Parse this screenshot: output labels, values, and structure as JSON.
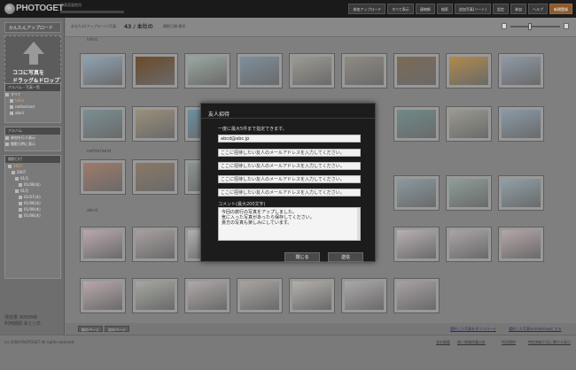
{
  "header": {
    "logo_text": "PHOTOGET",
    "logo_sub": "dreams",
    "meta_text": "写真容量使用",
    "nav": [
      "参加アップロード",
      "すべて表示",
      "連絡帳",
      "検索",
      "追加写真(ソート)",
      "設定",
      "参加",
      "ヘルプ",
      "新規登録"
    ]
  },
  "sidebar": {
    "upload_label": "かんたんアップロード",
    "drop_line1": "ココに写真を",
    "drop_line2": "ドラッグ&ドロップ",
    "albums_header": "アルバム・写真一覧",
    "albums": [
      {
        "label": "すべて",
        "style": "normal"
      },
      {
        "label": "tokio",
        "style": "orange"
      },
      {
        "label": "netherland",
        "style": "normal"
      },
      {
        "label": "abcd",
        "style": "normal"
      }
    ],
    "sub_header": "アルバム",
    "sub_items": [
      "参加を行う表示",
      "撮影日時に表示"
    ],
    "dates_header": "撮影日付",
    "dates": [
      "2007",
      "2007",
      "01月",
      "01/08(木)",
      "01月",
      "01/07(木)",
      "01/08(木)",
      "01/09(木)",
      "01/08(木)"
    ],
    "storage_line1": "残容量 9056MB",
    "storage_line2": "利用期間 あと○日"
  },
  "toolbar": {
    "count_label": "あなたの(アップロード)写真",
    "count_value": "43 / 本社の",
    "sort_label": "撮影日順 最初"
  },
  "groups": [
    {
      "label": "tokio"
    },
    {
      "label": "netherland"
    },
    {
      "label": "abcd"
    }
  ],
  "thumb_colors": {
    "row1": [
      "#8fa3b3",
      "#6b4a2a",
      "#9aa8a0",
      "#7e8f9c",
      "#9c9a92",
      "#8f8b82",
      "#7c6a55",
      "#b08a4a",
      "#8f99a6",
      "#6e5a50"
    ],
    "row2": [
      "#7a8f94",
      "#9a8f7a",
      "#6d8fa0",
      "#7f8c6a",
      "#8f7a6a",
      "#7a7e70",
      "#6f8a8a",
      "#9a9a90",
      "#8a9aa8",
      "#a0a4a8"
    ],
    "row3": [
      "#a07a6a",
      "#8a7866",
      "#8c9490",
      "#8a8e88",
      "#9a9692",
      "#a08e7e",
      "#8a9aa0",
      "#8e9e98",
      "#90a0a8"
    ],
    "row4": [
      "#b9a8ac",
      "#a8a0a0",
      "#b0b0b4",
      "#b4a8a8",
      "#a8b0a0",
      "#b8aeb0",
      "#b8b0b4",
      "#aaa4a8",
      "#b6a6a8",
      "#b4b0b0"
    ],
    "row5": [
      "#b8a8aa",
      "#a4a8a0",
      "#b0a8a8",
      "#a8a4a0",
      "#b4b0ac",
      "#aca8a8",
      "#a8a0a4",
      "#b0aaa8"
    ]
  },
  "main_footer": {
    "btn1": "前のページ",
    "btn2": "次のページ",
    "link1": "選択した写真をダウンロード",
    "link2": "選択した写真をslideshowにする"
  },
  "page_footer": {
    "copyright": "(c) 2008 PHOTOGET All rights reserved.",
    "links": [
      "会社概要",
      "個人情報保護方針",
      "利用規約",
      "特定商取引法に関する表示"
    ]
  },
  "modal": {
    "title": "友人招待",
    "hint": "一度に最大5件まで指定できます。",
    "email_1_value": "abcd@abc.jp",
    "email_placeholder": "ここに招待したい友人のメールアドレスを入力してください。",
    "comment_label": "コメント(最大200文字)",
    "comment_text": "今回の旅行の写真をアップしました。\n気に入った写真があったら保存してください。\n貴方の写真も楽しみにしています。",
    "close_label": "閉じる",
    "send_label": "送信"
  },
  "colors": {
    "header_bg": "#1a1a1a",
    "accent_orange": "#8a5a32",
    "modal_bg": "#1c1c1c",
    "overlay": "#7d7d7d"
  }
}
